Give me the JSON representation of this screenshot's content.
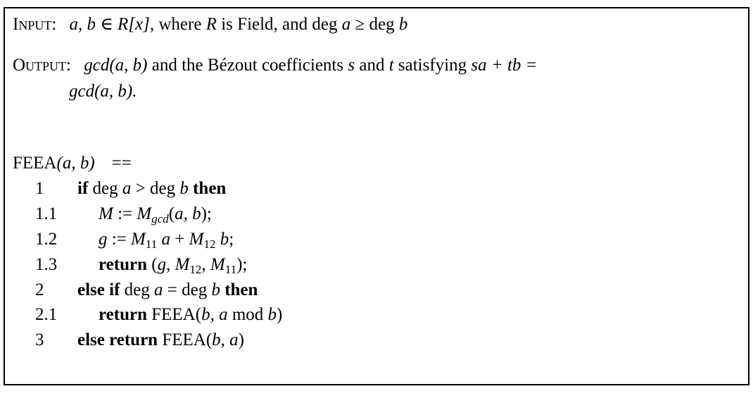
{
  "input": {
    "label": "Input:",
    "vars": "a, b",
    "elem": "∈",
    "ring": "R[x]",
    "rest1": ", where ",
    "R": "R",
    "rest2": " is Field, and ",
    "deg1": "deg ",
    "a": "a",
    "geq": " ≥ ",
    "deg2": "deg ",
    "b": "b"
  },
  "output": {
    "label": "Output:",
    "gcd1": "gcd(a, b)",
    "text1": " and the Bézout coefficients ",
    "s": "s",
    "and": " and ",
    "t": "t",
    "text2": " satisfying ",
    "eq": "sa + tb =",
    "gcd2": "gcd(a, b)."
  },
  "algorithm": {
    "header_name": "FEEA",
    "header_args": "(a, b)",
    "header_def": "==",
    "steps": [
      {
        "num": "1",
        "parts": [
          {
            "t": "if",
            "s": "bf"
          },
          {
            "t": " deg ",
            "s": ""
          },
          {
            "t": "a",
            "s": "it"
          },
          {
            "t": " > deg ",
            "s": ""
          },
          {
            "t": "b",
            "s": "it"
          },
          {
            "t": " then",
            "s": "bf"
          }
        ]
      },
      {
        "num": "1.1",
        "parts": [
          {
            "t": "M",
            "s": "it"
          },
          {
            "t": " := ",
            "s": ""
          },
          {
            "t": "M",
            "s": "it"
          },
          {
            "t": "gcd",
            "s": "sub-it"
          },
          {
            "t": "(",
            "s": ""
          },
          {
            "t": "a, b",
            "s": "it"
          },
          {
            "t": ");",
            "s": ""
          }
        ]
      },
      {
        "num": "1.2",
        "parts": [
          {
            "t": "g",
            "s": "it"
          },
          {
            "t": " := ",
            "s": ""
          },
          {
            "t": "M",
            "s": "it"
          },
          {
            "t": "11",
            "s": "sub"
          },
          {
            "t": " a",
            "s": "it"
          },
          {
            "t": " + ",
            "s": ""
          },
          {
            "t": "M",
            "s": "it"
          },
          {
            "t": "12",
            "s": "sub"
          },
          {
            "t": " b",
            "s": "it"
          },
          {
            "t": ";",
            "s": ""
          }
        ]
      },
      {
        "num": "1.3",
        "parts": [
          {
            "t": "return",
            "s": "bf"
          },
          {
            "t": " (",
            "s": ""
          },
          {
            "t": "g",
            "s": "it"
          },
          {
            "t": ", ",
            "s": ""
          },
          {
            "t": "M",
            "s": "it"
          },
          {
            "t": "12",
            "s": "sub"
          },
          {
            "t": ", ",
            "s": ""
          },
          {
            "t": "M",
            "s": "it"
          },
          {
            "t": "11",
            "s": "sub"
          },
          {
            "t": ");",
            "s": ""
          }
        ]
      },
      {
        "num": "2",
        "parts": [
          {
            "t": "else if",
            "s": "bf"
          },
          {
            "t": " deg ",
            "s": ""
          },
          {
            "t": "a",
            "s": "it"
          },
          {
            "t": " = deg ",
            "s": ""
          },
          {
            "t": "b",
            "s": "it"
          },
          {
            "t": " then",
            "s": "bf"
          }
        ]
      },
      {
        "num": "2.1",
        "parts": [
          {
            "t": "return",
            "s": "bf"
          },
          {
            "t": " FEEA(",
            "s": ""
          },
          {
            "t": "b, a",
            "s": "it"
          },
          {
            "t": " mod ",
            "s": ""
          },
          {
            "t": "b",
            "s": "it"
          },
          {
            "t": ")",
            "s": ""
          }
        ]
      },
      {
        "num": "3",
        "parts": [
          {
            "t": "else return",
            "s": "bf"
          },
          {
            "t": " FEEA(",
            "s": ""
          },
          {
            "t": "b, a",
            "s": "it"
          },
          {
            "t": ")",
            "s": ""
          }
        ]
      }
    ]
  }
}
